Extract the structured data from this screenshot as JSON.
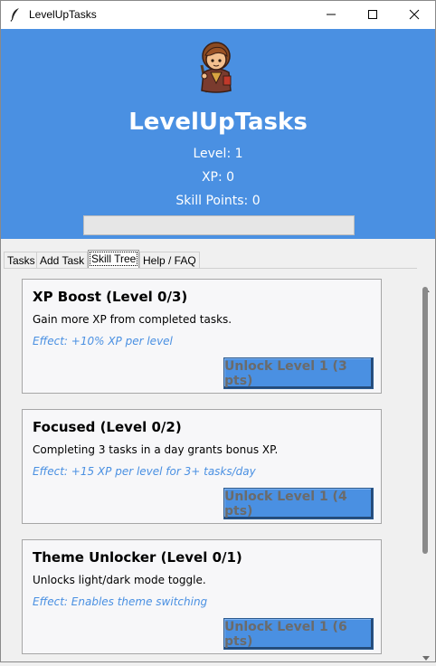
{
  "window": {
    "title": "LevelUpTasks",
    "icons": {
      "app": "feather-icon",
      "minimize": "minimize-icon",
      "maximize": "maximize-icon",
      "close": "close-icon"
    }
  },
  "header": {
    "avatar_icon": "adventurer-avatar-icon",
    "app_title": "LevelUpTasks",
    "level_text": "Level: 1",
    "xp_text": "XP: 0",
    "skill_points_text": "Skill Points: 0",
    "xp_progress": 0,
    "accent_color": "#4a90e2"
  },
  "tabs": [
    {
      "label": "Tasks",
      "active": false
    },
    {
      "label": "Add Task",
      "active": false
    },
    {
      "label": "Skill Tree",
      "active": true
    },
    {
      "label": "Help / FAQ",
      "active": false
    }
  ],
  "skills": [
    {
      "title": "XP Boost (Level 0/3)",
      "description": "Gain more XP from completed tasks.",
      "effect": "Effect: +10% XP per level",
      "button_label": "Unlock Level 1 (3 pts)"
    },
    {
      "title": "Focused (Level 0/2)",
      "description": "Completing 3 tasks in a day grants bonus XP.",
      "effect": "Effect: +15 XP per level for 3+ tasks/day",
      "button_label": "Unlock Level 1 (4 pts)"
    },
    {
      "title": "Theme Unlocker (Level 0/1)",
      "description": "Unlocks light/dark mode toggle.",
      "effect": "Effect: Enables theme switching",
      "button_label": "Unlock Level 1 (6 pts)"
    }
  ],
  "scrollbar": {
    "up_icon": "scroll-up-arrow-icon",
    "down_icon": "scroll-down-arrow-icon"
  }
}
